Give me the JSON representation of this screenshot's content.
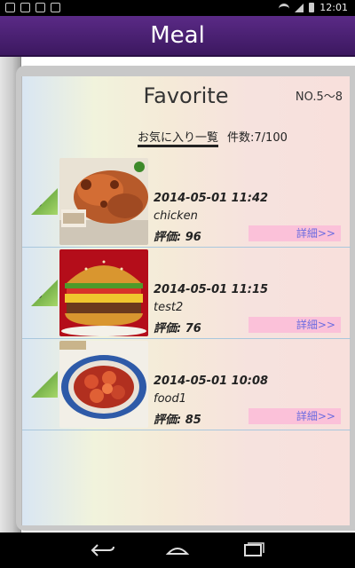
{
  "status_bar": {
    "time": "12:01"
  },
  "app": {
    "title": "Meal"
  },
  "header": {
    "title": "Favorite",
    "range": "NO.5〜8"
  },
  "subheader": {
    "tab_label": "お気に入り一覧",
    "count_text": "件数:7/100"
  },
  "items": [
    {
      "index": "5",
      "date": "2014-05-01 11:42",
      "name": "chicken",
      "rating": "評価: 96",
      "detail_label": "詳細>>"
    },
    {
      "index": "6",
      "date": "2014-05-01 11:15",
      "name": "test2",
      "rating": "評価: 76",
      "detail_label": "詳細>>"
    },
    {
      "index": "7",
      "date": "2014-05-01 10:08",
      "name": "food1",
      "rating": "評価: 85",
      "detail_label": "詳細>>"
    }
  ],
  "icons": {
    "back": "back-icon",
    "home": "home-icon",
    "recent": "recent-apps-icon"
  }
}
